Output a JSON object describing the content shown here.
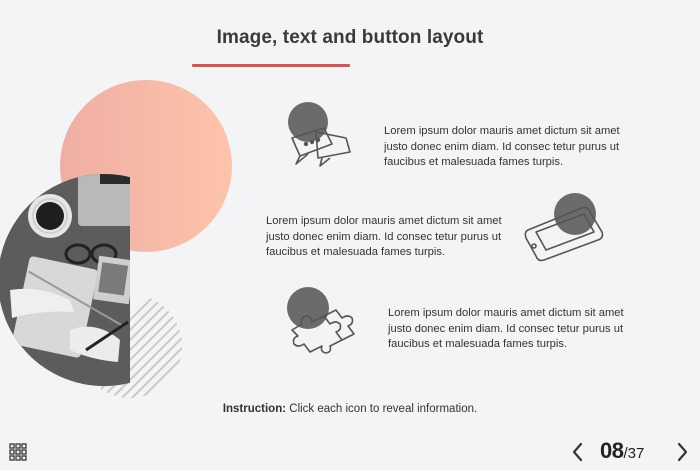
{
  "slide": {
    "title": "Image, text and button layout",
    "items": [
      {
        "icon": "chat-bubbles-icon",
        "text": "Lorem ipsum dolor mauris amet dictum sit amet justo donec enim diam. Id consec tetur purus ut faucibus et malesuada fames turpis."
      },
      {
        "icon": "smartphone-icon",
        "text": "Lorem ipsum dolor mauris amet dictum sit amet justo donec enim diam. Id consec tetur purus ut faucibus et malesuada fames turpis."
      },
      {
        "icon": "puzzle-piece-icon",
        "text": "Lorem ipsum dolor mauris amet dictum sit amet justo donec enim diam. Id consec tetur purus ut faucibus et malesuada fames turpis."
      }
    ],
    "instruction_label": "Instruction:",
    "instruction_text": " Click each icon to reveal information."
  },
  "colors": {
    "accent": "#d9534f",
    "circle_gradient_start": "#f0b1a6",
    "circle_gradient_end": "#fcc3a9",
    "icon_dot": "#6b6b6b"
  },
  "navigation": {
    "current_page": "08",
    "total_pages": "/37",
    "menu_icon": "grid-menu-icon",
    "prev_icon": "chevron-left-icon",
    "next_icon": "chevron-right-icon"
  }
}
